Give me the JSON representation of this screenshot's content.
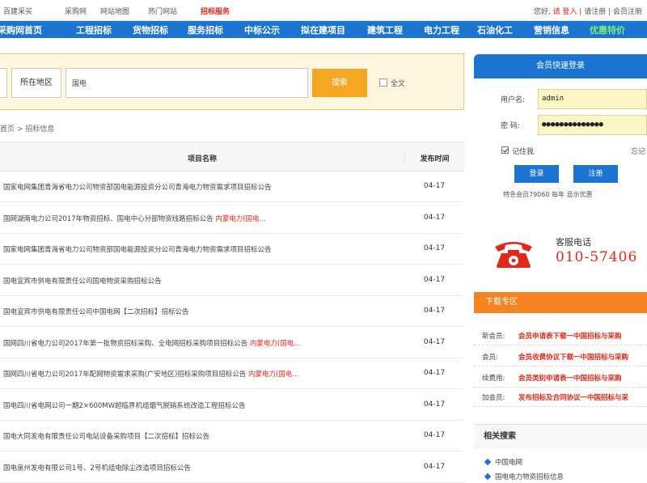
{
  "topbar": {
    "links": [
      "百建采买",
      "采购网",
      "网站地图",
      "热门网站",
      "招标服务"
    ],
    "right": {
      "prefix": "您好,",
      "login": "请 登入",
      "register": "请注册",
      "vip": "会员注册"
    }
  },
  "nav": {
    "items": [
      "采购网首页",
      "工程招标",
      "货物招标",
      "服务招标",
      "中标公示",
      "拟在建项目",
      "建筑工程",
      "电力工程",
      "石油化工",
      "营销信息",
      "优惠特价"
    ]
  },
  "search": {
    "region": "所在地区",
    "query": "国电",
    "button": "搜索",
    "option": "全文"
  },
  "breadcrumb": "首页 > 招标信息",
  "table": {
    "headers": {
      "name": "项目名称",
      "date": "发布时间"
    },
    "rows": [
      {
        "name": "国家电网集团青海省电力公司物资部国电能源投资分公司青海电力物资需求项目招标公告",
        "tag": "",
        "date": "04-17"
      },
      {
        "name": "国网湖南电力公司2017年物资招标、国电中心分部物资线路招标公告",
        "tag": "内蒙电力(国电...",
        "date": "04-17"
      },
      {
        "name": "国家电网集团青海省电力公司物资部国电能源投资分公司青海电力物资需求项目招标公告",
        "tag": "",
        "date": "04-17"
      },
      {
        "name": "国电宜宾市供电有限责任公司国电物资采购招标公告",
        "tag": "",
        "date": "04-17"
      },
      {
        "name": "国电宜宾市供电有限责任公司中国电网【二次招标】招标公告",
        "tag": "",
        "date": "04-17"
      },
      {
        "name": "国网四川省电力公司2017年第一批物资招标采购、全电网招标采购项目招标公告",
        "tag": "内蒙电力(国电...",
        "date": "04-17"
      },
      {
        "name": "国网四川省电力公司2017年配网物资需求采购(广安地区)招标采购项目招标公告",
        "tag": "内蒙电力(国电...",
        "date": "04-17"
      },
      {
        "name": "国电四川省电网公司一期2×600MW超临界机组烟气脱硝系统改造工程招标公告",
        "tag": "",
        "date": "04-17"
      },
      {
        "name": "国电大同发电有限责任公司电站设备采购项目【二次招标】招标公告",
        "tag": "",
        "date": "04-17"
      },
      {
        "name": "国电泉州发电有限公司1号、2号机组电除尘改造项目招标公告",
        "tag": "",
        "date": "04-17"
      }
    ]
  },
  "login": {
    "title": "会员快速登录",
    "user_label": "用户名:",
    "user_value": "admin",
    "pass_label": "密 码:",
    "pass_value": "●●●●●●●●●●●●●●",
    "remember": "记住我",
    "forgot": "忘记",
    "login_btn": "登录",
    "register_btn": "注册",
    "note": "特急会员79060 每年 显示优惠"
  },
  "hotline": {
    "label": "客服电话",
    "number": "010-57406"
  },
  "download": {
    "title": "下载专区",
    "rows": [
      {
        "k": "新会员:",
        "v": "会员申请表下载一中国招标与采购"
      },
      {
        "k": "会员:",
        "v": "会员收费协议下载一中国招标与采购"
      },
      {
        "k": "续费用:",
        "v": "会员类别申请表一中国招标与采购"
      },
      {
        "k": "加会员:",
        "v": "发布招标及合同协议一中国招标与采"
      }
    ]
  },
  "related": {
    "title": "相关搜索",
    "items": [
      "中国电网",
      "国电电力物资招标信息"
    ]
  },
  "colors": {
    "nav": "#1b74d0",
    "accent": "#f5a623",
    "download": "#f5831f",
    "red": "#e0281b"
  }
}
